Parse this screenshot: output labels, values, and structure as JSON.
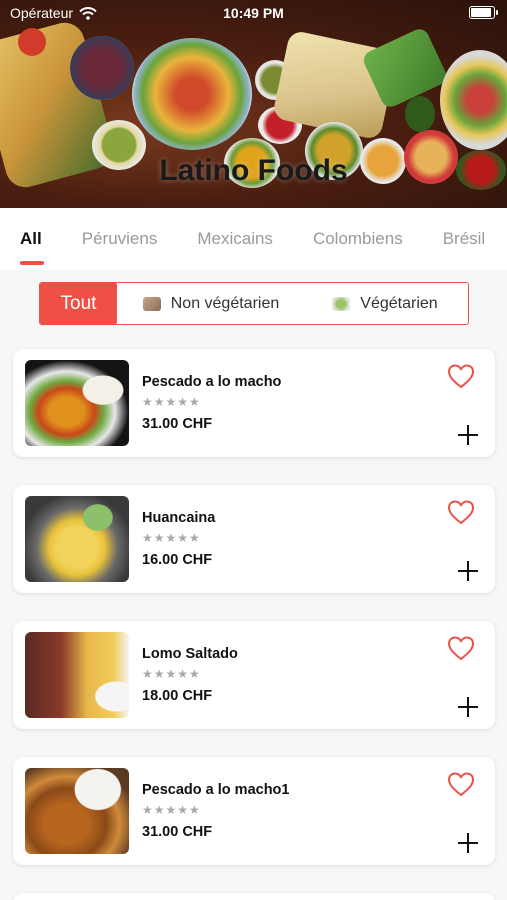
{
  "status_bar": {
    "carrier": "Opérateur",
    "time": "10:49 PM"
  },
  "hero": {
    "title": "Latino Foods"
  },
  "category_tabs": [
    {
      "label": "All",
      "active": true
    },
    {
      "label": "Péruviens",
      "active": false
    },
    {
      "label": "Mexicains",
      "active": false
    },
    {
      "label": "Colombiens",
      "active": false
    },
    {
      "label": "Brésil",
      "active": false
    }
  ],
  "filters": {
    "all_label": "Tout",
    "non_veg_label": "Non végétarien",
    "veg_label": "Végétarien"
  },
  "products": [
    {
      "name": "Pescado a lo macho",
      "stars": "★★★★★",
      "price": "31.00 CHF"
    },
    {
      "name": "Huancaina",
      "stars": "★★★★★",
      "price": "16.00 CHF"
    },
    {
      "name": "Lomo Saltado",
      "stars": "★★★★★",
      "price": "18.00 CHF"
    },
    {
      "name": "Pescado a lo macho1",
      "stars": "★★★★★",
      "price": "31.00 CHF"
    }
  ],
  "colors": {
    "accent": "#ee5045",
    "heart": "#ee5045",
    "text": "#111111",
    "muted": "#9a9a9a"
  },
  "icons": {
    "wifi": "wifi-icon",
    "battery": "battery-icon",
    "favorite": "heart-outline-icon",
    "add": "plus-icon"
  }
}
